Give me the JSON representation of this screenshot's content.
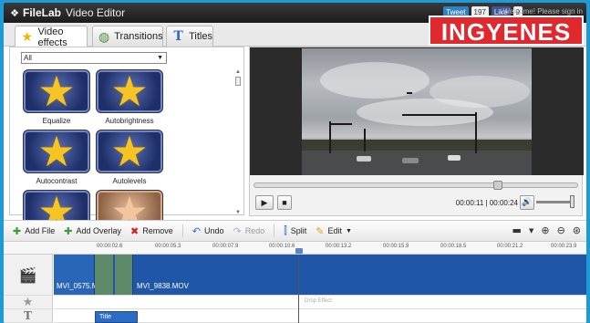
{
  "app": {
    "logo": "FileLab",
    "name": "Video Editor"
  },
  "header": {
    "tweet": "Tweet",
    "tweet_count": "197",
    "like": "Like",
    "like_count": "9",
    "signin": "Welcome! Please sign in"
  },
  "promo": "INGYENES",
  "tabs": [
    {
      "label": "Video effects",
      "icon": "star-icon",
      "active": true
    },
    {
      "label": "Transitions",
      "icon": "transitions-icon",
      "active": false
    },
    {
      "label": "Titles",
      "icon": "titles-icon",
      "active": false
    }
  ],
  "effects": {
    "filter": "All",
    "items": [
      {
        "label": "Equalize"
      },
      {
        "label": "Autobrightness"
      },
      {
        "label": "Autocontrast"
      },
      {
        "label": "Autolevels"
      },
      {
        "label": ""
      },
      {
        "label": ""
      }
    ]
  },
  "player": {
    "timecode": "00:00:11 | 00:00:24",
    "progress": 0.755,
    "volume": 1.0
  },
  "toolbar": {
    "add_file": "Add File",
    "add_overlay": "Add Overlay",
    "remove": "Remove",
    "undo": "Undo",
    "redo": "Redo",
    "split": "Split",
    "edit": "Edit"
  },
  "ruler": [
    "00:00:02.6",
    "00:00:05.3",
    "00:00:07.9",
    "00:00:10.6",
    "00:00:13.2",
    "00:00:15.9",
    "00:00:18.5",
    "00:00:21.2",
    "00:00:23.9"
  ],
  "timeline": {
    "clips": [
      {
        "label": "MVI_0575.M"
      },
      {
        "label": "MVI_9838.MOV"
      }
    ],
    "drop_effect": "Drop Effect",
    "title_clip": "Title"
  },
  "colors": {
    "accent": "#1e9bd7",
    "promo": "#e0282f",
    "clip": "#1f56a8"
  }
}
